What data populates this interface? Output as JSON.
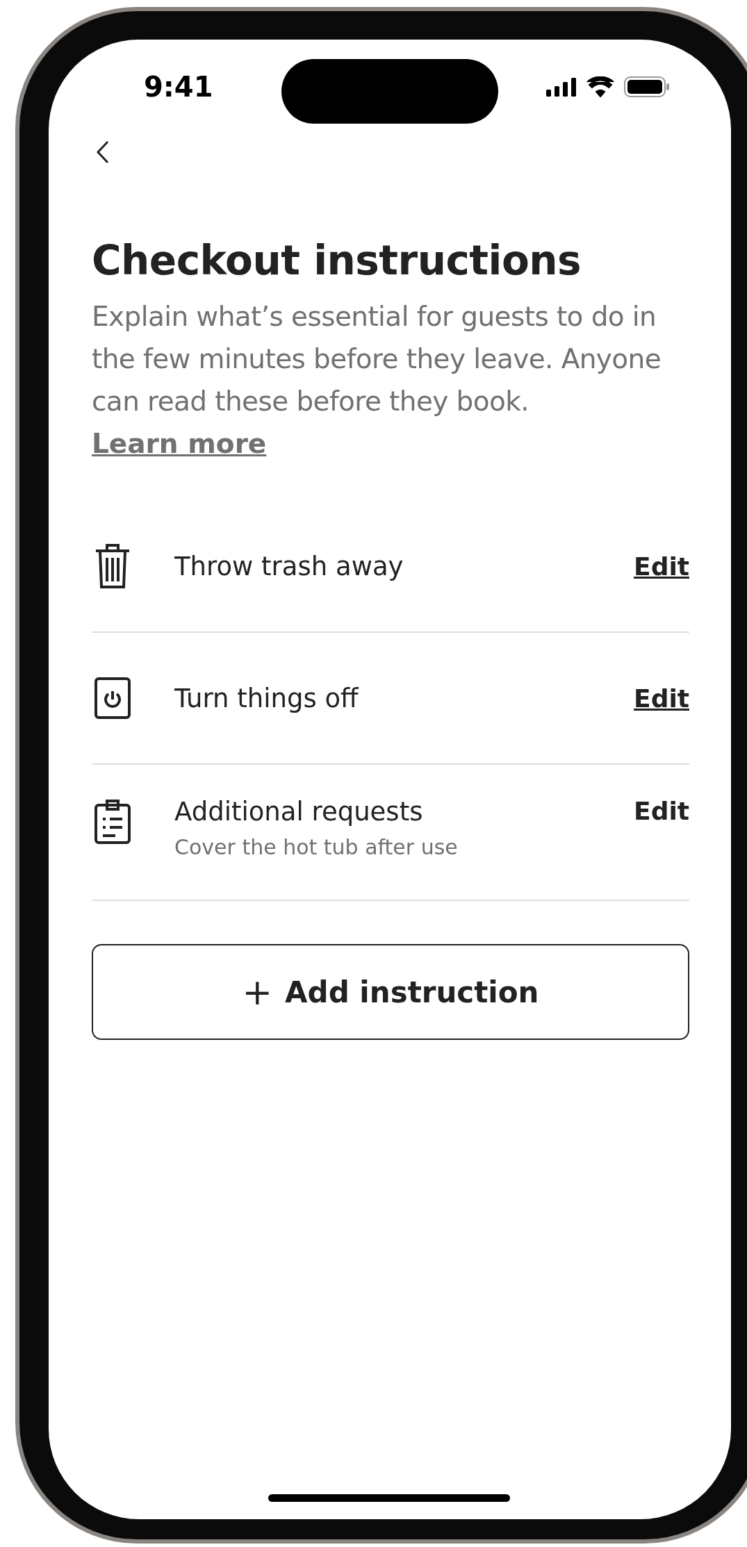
{
  "status_bar": {
    "time": "9:41"
  },
  "title": "Checkout instructions",
  "description": "Explain what’s essential for guests to do in the few minutes before they leave. Anyone can read these before they book.",
  "learn_more": "Learn more",
  "instructions": [
    {
      "kind": "trash",
      "label": "Throw trash away",
      "edit": "Edit",
      "underlined": true
    },
    {
      "kind": "power",
      "label": "Turn things off",
      "edit": "Edit",
      "underlined": true
    },
    {
      "kind": "clipboard",
      "label": "Additional requests",
      "subtitle": "Cover the hot tub after use",
      "edit": "Edit",
      "underlined": false
    }
  ],
  "add_button": {
    "icon": "+",
    "label": "Add instruction"
  }
}
